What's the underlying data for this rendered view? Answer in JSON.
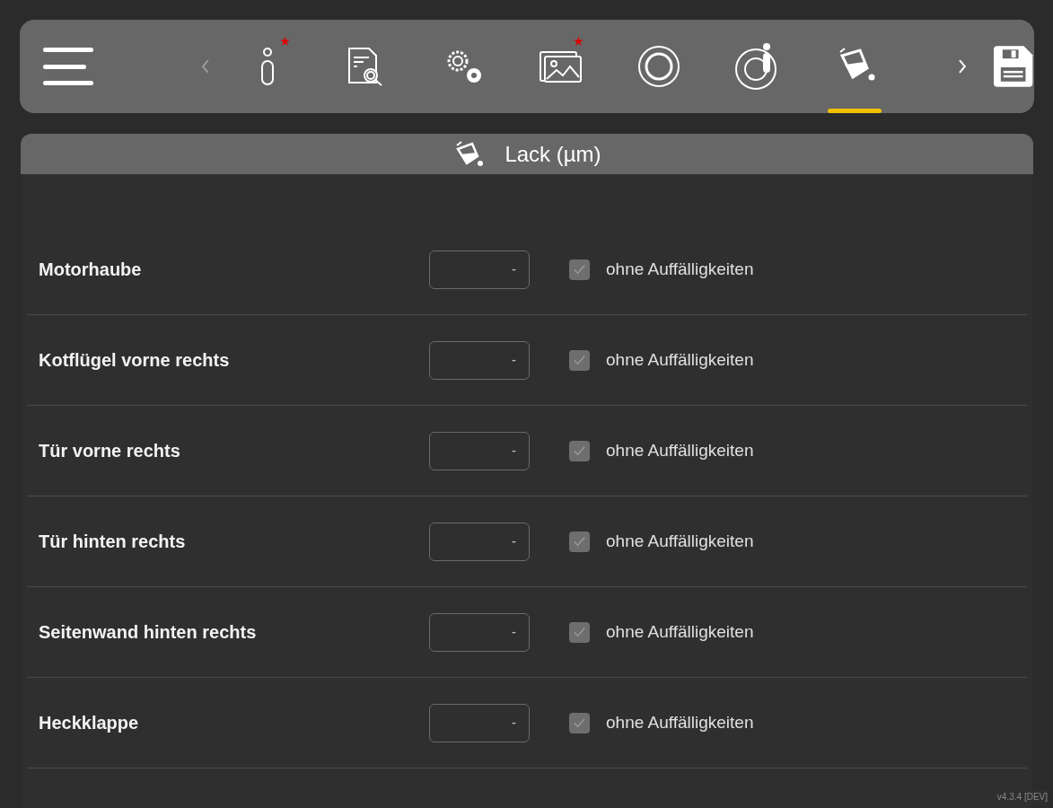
{
  "toolbar": {
    "tabs": [
      {
        "kind": "info",
        "selected": false,
        "required": true
      },
      {
        "kind": "document-search",
        "selected": false,
        "required": false
      },
      {
        "kind": "gears",
        "selected": false,
        "required": false
      },
      {
        "kind": "images",
        "selected": false,
        "required": true
      },
      {
        "kind": "ring",
        "selected": false,
        "required": false
      },
      {
        "kind": "ring-info",
        "selected": false,
        "required": false
      },
      {
        "kind": "paint",
        "selected": true,
        "required": false
      }
    ]
  },
  "section": {
    "title": "Lack (µm)"
  },
  "rows": [
    {
      "label": "Motorhaube",
      "value": "-",
      "checked": true,
      "check_label": "ohne Auffälligkeiten"
    },
    {
      "label": "Kotflügel vorne rechts",
      "value": "-",
      "checked": true,
      "check_label": "ohne Auffälligkeiten"
    },
    {
      "label": "Tür vorne rechts",
      "value": "-",
      "checked": true,
      "check_label": "ohne Auffälligkeiten"
    },
    {
      "label": "Tür hinten rechts",
      "value": "-",
      "checked": true,
      "check_label": "ohne Auffälligkeiten"
    },
    {
      "label": "Seitenwand hinten rechts",
      "value": "-",
      "checked": true,
      "check_label": "ohne Auffälligkeiten"
    },
    {
      "label": "Heckklappe",
      "value": "-",
      "checked": true,
      "check_label": "ohne Auffälligkeiten"
    }
  ],
  "version": "v4.3.4 [DEV]"
}
